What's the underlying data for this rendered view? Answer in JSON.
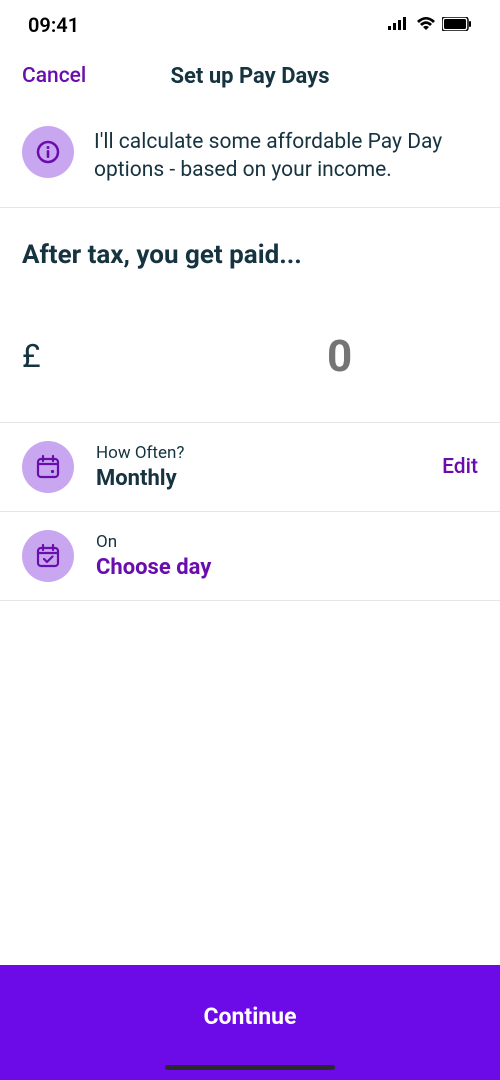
{
  "status": {
    "time": "09:41"
  },
  "nav": {
    "cancel_label": "Cancel",
    "title": "Set up Pay Days"
  },
  "info": {
    "text": "I'll calculate some affordable Pay Day options - based on your income."
  },
  "heading": "After tax, you get paid...",
  "amount": {
    "currency": "£",
    "placeholder": "0",
    "value": ""
  },
  "options": {
    "frequency": {
      "label": "How Often?",
      "value": "Monthly",
      "action_label": "Edit"
    },
    "day": {
      "label": "On",
      "value": "Choose day"
    }
  },
  "continue_label": "Continue"
}
